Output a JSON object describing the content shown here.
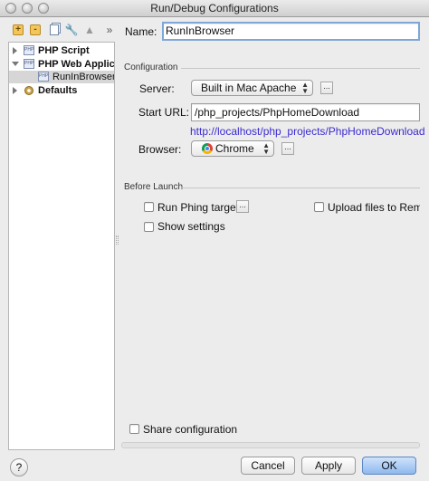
{
  "window": {
    "title": "Run/Debug Configurations"
  },
  "left_toolbar": {
    "icons": [
      "add-icon",
      "remove-icon",
      "copy-icon",
      "wrench-icon",
      "move-up-icon",
      "more-icon"
    ],
    "more_glyph": "»"
  },
  "tree": {
    "items": [
      {
        "label": "PHP Script",
        "icon": "php-icon"
      },
      {
        "label": "PHP Web Application",
        "icon": "php-icon"
      },
      {
        "label": "RunInBrowser",
        "icon": "php-icon"
      },
      {
        "label": "Defaults",
        "icon": "defaults-icon"
      }
    ],
    "php_icon_text": "PHP"
  },
  "form": {
    "name_label": "Name:",
    "name_value": "RunInBrowser",
    "configuration_section": "Configuration",
    "server_label": "Server:",
    "server_value": "Built in Mac Apache",
    "start_url_label": "Start URL:",
    "start_url_value": "/php_projects/PhpHomeDownload",
    "resolved_url": "http://localhost/php_projects/PhpHomeDownload",
    "browser_label": "Browser:",
    "browser_value": "Chrome",
    "before_launch_section": "Before Launch",
    "run_phing_label": "Run Phing target",
    "upload_files_label": "Upload files to Remote",
    "show_settings_label": "Show settings",
    "share_label": "Share configuration",
    "ellipsis": "..."
  },
  "buttons": {
    "help": "?",
    "cancel": "Cancel",
    "apply": "Apply",
    "ok": "OK"
  },
  "colors": {
    "link": "#3b2bd1",
    "selection": "#d6d6d6",
    "primary_button": "#8fb8ee"
  }
}
